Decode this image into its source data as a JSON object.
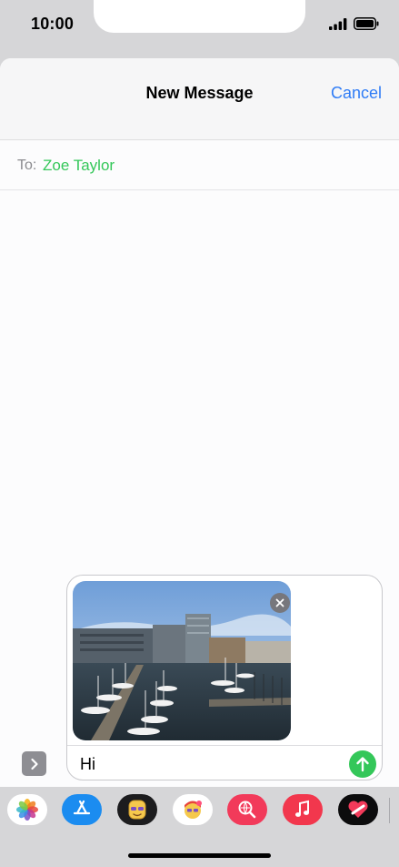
{
  "status_bar": {
    "time": "10:00",
    "signal_icon": "cellular-signal-icon",
    "battery_icon": "battery-icon"
  },
  "header": {
    "title": "New Message",
    "cancel_label": "Cancel"
  },
  "recipient": {
    "label": "To:",
    "name": "Zoe Taylor"
  },
  "compose": {
    "message_text": "Hi",
    "attachment_icon": "photo-thumbnail",
    "remove_icon": "close-icon",
    "send_icon": "arrow-up-icon"
  },
  "expand_icon": "chevron-right-icon",
  "app_drawer": [
    {
      "name": "photos-app-icon"
    },
    {
      "name": "app-store-icon"
    },
    {
      "name": "memoji-icon"
    },
    {
      "name": "memoji-stickers-icon"
    },
    {
      "name": "images-search-icon"
    },
    {
      "name": "music-icon"
    },
    {
      "name": "digital-touch-icon"
    }
  ],
  "colors": {
    "accent_blue": "#2f7cf6",
    "accent_green": "#34c759"
  }
}
